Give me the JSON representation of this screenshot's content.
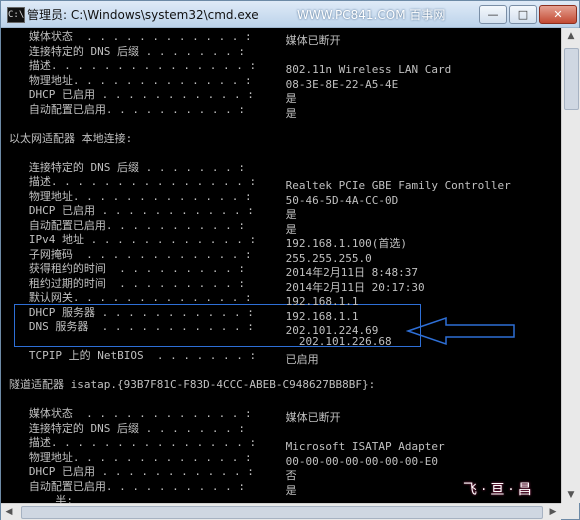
{
  "window": {
    "title": "管理员: C:\\Windows\\system32\\cmd.exe",
    "watermark": "WWW.PC841.COM 百事网",
    "minimize_label": "—",
    "maximize_label": "□",
    "close_label": "✕",
    "icon_label": "C:\\"
  },
  "console": {
    "lines": [
      {
        "key": "   媒体状态  . . . . . . . . . . . . :",
        "value": " 媒体已断开"
      },
      {
        "key": "   连接特定的 DNS 后缀 . . . . . . . :",
        "value": ""
      },
      {
        "key": "   描述. . . . . . . . . . . . . . . :",
        "value": " 802.11n Wireless LAN Card"
      },
      {
        "key": "   物理地址. . . . . . . . . . . . . :",
        "value": " 08-3E-8E-22-A5-4E"
      },
      {
        "key": "   DHCP 已启用 . . . . . . . . . . . :",
        "value": " 是"
      },
      {
        "key": "   自动配置已启用. . . . . . . . . . :",
        "value": " 是"
      },
      {
        "key": "",
        "value": ""
      },
      {
        "key": "以太网适配器 本地连接:",
        "value": ""
      },
      {
        "key": "",
        "value": ""
      },
      {
        "key": "   连接特定的 DNS 后缀 . . . . . . . :",
        "value": ""
      },
      {
        "key": "   描述. . . . . . . . . . . . . . . :",
        "value": " Realtek PCIe GBE Family Controller"
      },
      {
        "key": "   物理地址. . . . . . . . . . . . . :",
        "value": " 50-46-5D-4A-CC-0D"
      },
      {
        "key": "   DHCP 已启用 . . . . . . . . . . . :",
        "value": " 是"
      },
      {
        "key": "   自动配置已启用. . . . . . . . . . :",
        "value": " 是"
      },
      {
        "key": "   IPv4 地址 . . . . . . . . . . . . :",
        "value": " 192.168.1.100(首选)"
      },
      {
        "key": "   子网掩码  . . . . . . . . . . . . :",
        "value": " 255.255.255.0"
      },
      {
        "key": "   获得租约的时间  . . . . . . . . . :",
        "value": " 2014年2月11日 8:48:37"
      },
      {
        "key": "   租约过期的时间  . . . . . . . . . :",
        "value": " 2014年2月11日 20:17:30"
      },
      {
        "key": "   默认网关. . . . . . . . . . . . . :",
        "value": " 192.168.1.1"
      },
      {
        "key": "   DHCP 服务器 . . . . . . . . . . . :",
        "value": " 192.168.1.1"
      },
      {
        "key": "   DNS 服务器  . . . . . . . . . . . :",
        "value": " 202.101.224.69"
      },
      {
        "key": "",
        "value": "   202.101.226.68"
      },
      {
        "key": "   TCPIP 上的 NetBIOS  . . . . . . . :",
        "value": " 已启用"
      },
      {
        "key": "",
        "value": ""
      },
      {
        "key": "隧道适配器 isatap.{93B7F81C-F83D-4CCC-ABEB-C948627BB8BF}:",
        "value": ""
      },
      {
        "key": "",
        "value": ""
      },
      {
        "key": "   媒体状态  . . . . . . . . . . . . :",
        "value": " 媒体已断开"
      },
      {
        "key": "   连接特定的 DNS 后缀 . . . . . . . :",
        "value": ""
      },
      {
        "key": "   描述. . . . . . . . . . . . . . . :",
        "value": " Microsoft ISATAP Adapter"
      },
      {
        "key": "   物理地址. . . . . . . . . . . . . :",
        "value": " 00-00-00-00-00-00-00-E0"
      },
      {
        "key": "   DHCP 已启用 . . . . . . . . . . . :",
        "value": " 否"
      },
      {
        "key": "   自动配置已启用. . . . . . . . . . :",
        "value": " 是"
      },
      {
        "key": "       半:",
        "value": ""
      }
    ],
    "text_color": "#c0c0c0",
    "background": "#000000",
    "highlight_color": "#2e6fd6"
  },
  "brand": "飞 · 亘 · 昌"
}
